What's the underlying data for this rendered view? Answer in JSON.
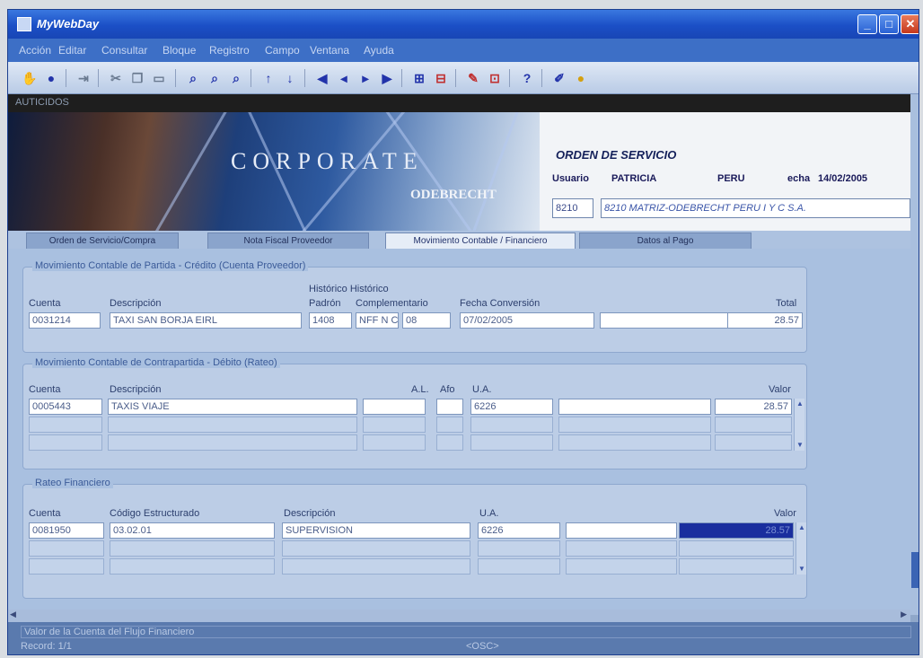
{
  "window": {
    "title": "MyWebDay",
    "min": "_",
    "max": "□",
    "close": "✕"
  },
  "menu": [
    "Acción",
    "Editar",
    "Consultar",
    "Bloque",
    "Registro",
    "Campo",
    "Ventana",
    "Ayuda"
  ],
  "toolbar": {
    "icons": [
      {
        "name": "save-icon",
        "glyph": "✋",
        "color": "gold"
      },
      {
        "name": "print-icon",
        "glyph": "●",
        "color": "blue"
      },
      {
        "name": "exit-icon",
        "glyph": "⇥",
        "color": "gray"
      },
      {
        "name": "cut-icon",
        "glyph": "✂",
        "color": "gray"
      },
      {
        "name": "copy-icon",
        "glyph": "❐",
        "color": "gray"
      },
      {
        "name": "paste-icon",
        "glyph": "▭",
        "color": "gray"
      },
      {
        "name": "query-icon",
        "glyph": "⌕",
        "color": "blue"
      },
      {
        "name": "execute-query-icon",
        "glyph": "⌕",
        "color": "blue"
      },
      {
        "name": "cancel-query-icon",
        "glyph": "⌕",
        "color": "blue"
      },
      {
        "name": "arrow-up-icon",
        "glyph": "↑",
        "color": "blue"
      },
      {
        "name": "arrow-down-icon",
        "glyph": "↓",
        "color": "blue"
      },
      {
        "name": "first-record-icon",
        "glyph": "◀",
        "color": "blue"
      },
      {
        "name": "previous-record-icon",
        "glyph": "◂",
        "color": "blue"
      },
      {
        "name": "next-record-icon",
        "glyph": "▸",
        "color": "blue"
      },
      {
        "name": "last-record-icon",
        "glyph": "▶",
        "color": "blue"
      },
      {
        "name": "insert-record-icon",
        "glyph": "⊞",
        "color": "blue"
      },
      {
        "name": "delete-record-icon",
        "glyph": "⊟",
        "color": "red"
      },
      {
        "name": "clear-icon",
        "glyph": "✎",
        "color": "red"
      },
      {
        "name": "lock-icon",
        "glyph": "⊡",
        "color": "red"
      },
      {
        "name": "help-icon",
        "glyph": "?",
        "color": "blue"
      },
      {
        "name": "edit-icon",
        "glyph": "✐",
        "color": "blue"
      },
      {
        "name": "hint-icon",
        "glyph": "●",
        "color": "gold"
      }
    ]
  },
  "subbar": {
    "label": "AUTICIDOS"
  },
  "banner": {
    "corporate": "CORPORATE",
    "odebrecht": "ODEBRECHT",
    "form_title": "ORDEN DE SERVICIO",
    "user_label": "Usuario",
    "user_value": "PATRICIA",
    "country": "PERU",
    "date_label": "echa",
    "date_value": "14/02/2005",
    "company_code": "8210",
    "company_desc": "8210 MATRIZ-ODEBRECHT PERU I Y C S.A."
  },
  "tabs": [
    "Orden de Servicio/Compra",
    "Nota Fiscal Proveedor",
    "Movimiento Contable / Financiero",
    "Datos al Pago"
  ],
  "credit": {
    "title": "Movimiento Contable de Partida - Crédito (Cuenta Proveedor)",
    "headers": {
      "cuenta": "Cuenta",
      "descripcion": "Descripción",
      "historico_top": "Histórico Histórico",
      "padron": "Padrón",
      "complementario": "Complementario",
      "fecha": "Fecha Conversión",
      "total": "Total"
    },
    "row": {
      "cuenta": "0031214",
      "descripcion": "TAXI SAN BORJA EIRL",
      "padron": "1408",
      "complementario": "NFF N C",
      "comp2": "08",
      "fecha": "07/02/2005",
      "blank": "",
      "total": "28.57"
    }
  },
  "debit": {
    "title": "Movimiento Contable de Contrapartida - Débito (Rateo)",
    "headers": {
      "cuenta": "Cuenta",
      "descripcion": "Descripción",
      "al": "A.L.",
      "afo": "Afo",
      "ua": "U.A.",
      "valor": "Valor"
    },
    "rows": [
      {
        "cuenta": "0005443",
        "descripcion": "TAXIS VIAJE",
        "al": "",
        "afo": "",
        "ua": "6226",
        "blank": "",
        "valor": "28.57"
      },
      {
        "cuenta": "",
        "descripcion": "",
        "al": "",
        "afo": "",
        "ua": "",
        "blank": "",
        "valor": ""
      },
      {
        "cuenta": "",
        "descripcion": "",
        "al": "",
        "afo": "",
        "ua": "",
        "blank": "",
        "valor": ""
      }
    ]
  },
  "financial": {
    "title": "Rateo Financiero",
    "headers": {
      "cuenta": "Cuenta",
      "codigo": "Código Estructurado",
      "descripcion": "Descripción",
      "ua": "U.A.",
      "valor": "Valor"
    },
    "rows": [
      {
        "cuenta": "0081950",
        "codigo": "03.02.01",
        "descripcion": "SUPERVISION",
        "ua": "6226",
        "blank": "",
        "valor": "28.57"
      },
      {
        "cuenta": "",
        "codigo": "",
        "descripcion": "",
        "ua": "",
        "blank": "",
        "valor": ""
      },
      {
        "cuenta": "",
        "codigo": "",
        "descripcion": "",
        "ua": "",
        "blank": "",
        "valor": ""
      }
    ]
  },
  "status": {
    "message": "Valor de la Cuenta del Flujo Financiero",
    "record": "Record: 1/1",
    "osc": "<OSC>"
  }
}
